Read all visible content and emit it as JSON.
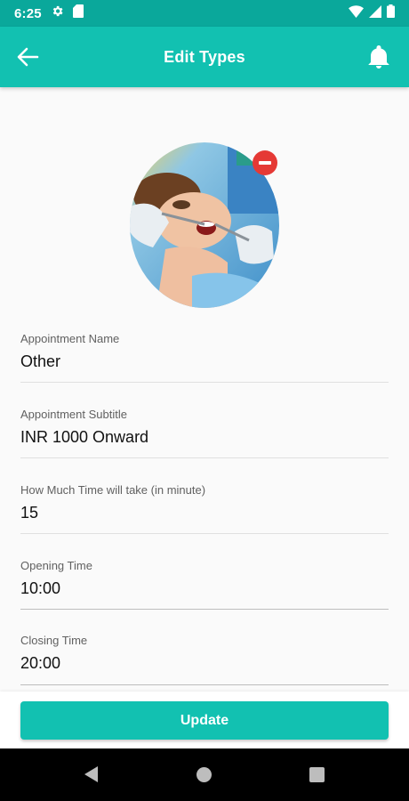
{
  "status_bar": {
    "time": "6:25",
    "icons": [
      "settings-icon",
      "sd-card-icon",
      "wifi-icon",
      "signal-icon",
      "battery-icon"
    ]
  },
  "app_bar": {
    "title": "Edit Types",
    "left_icon": "arrow-left-icon",
    "right_icon": "bell-icon"
  },
  "avatar": {
    "description_icon": "dentist-photo",
    "remove_icon": "remove-circle-icon"
  },
  "fields": [
    {
      "label": "Appointment Name",
      "value": "Other"
    },
    {
      "label": "Appointment Subtitle",
      "value": "INR 1000 Onward"
    },
    {
      "label": "How Much Time will take (in minute)",
      "value": "15"
    },
    {
      "label": "Opening Time",
      "value": "10:00"
    },
    {
      "label": "Closing Time",
      "value": "20:00"
    }
  ],
  "update_button": {
    "label": "Update"
  },
  "nav_bar": {
    "icons": [
      "nav-back-icon",
      "nav-home-icon",
      "nav-recents-icon"
    ]
  },
  "colors": {
    "status_bar": "#0aa89b",
    "app_bar": "#12c1b1",
    "accent": "#12c1b1",
    "remove_badge": "#e53935",
    "background": "#fafafa"
  }
}
